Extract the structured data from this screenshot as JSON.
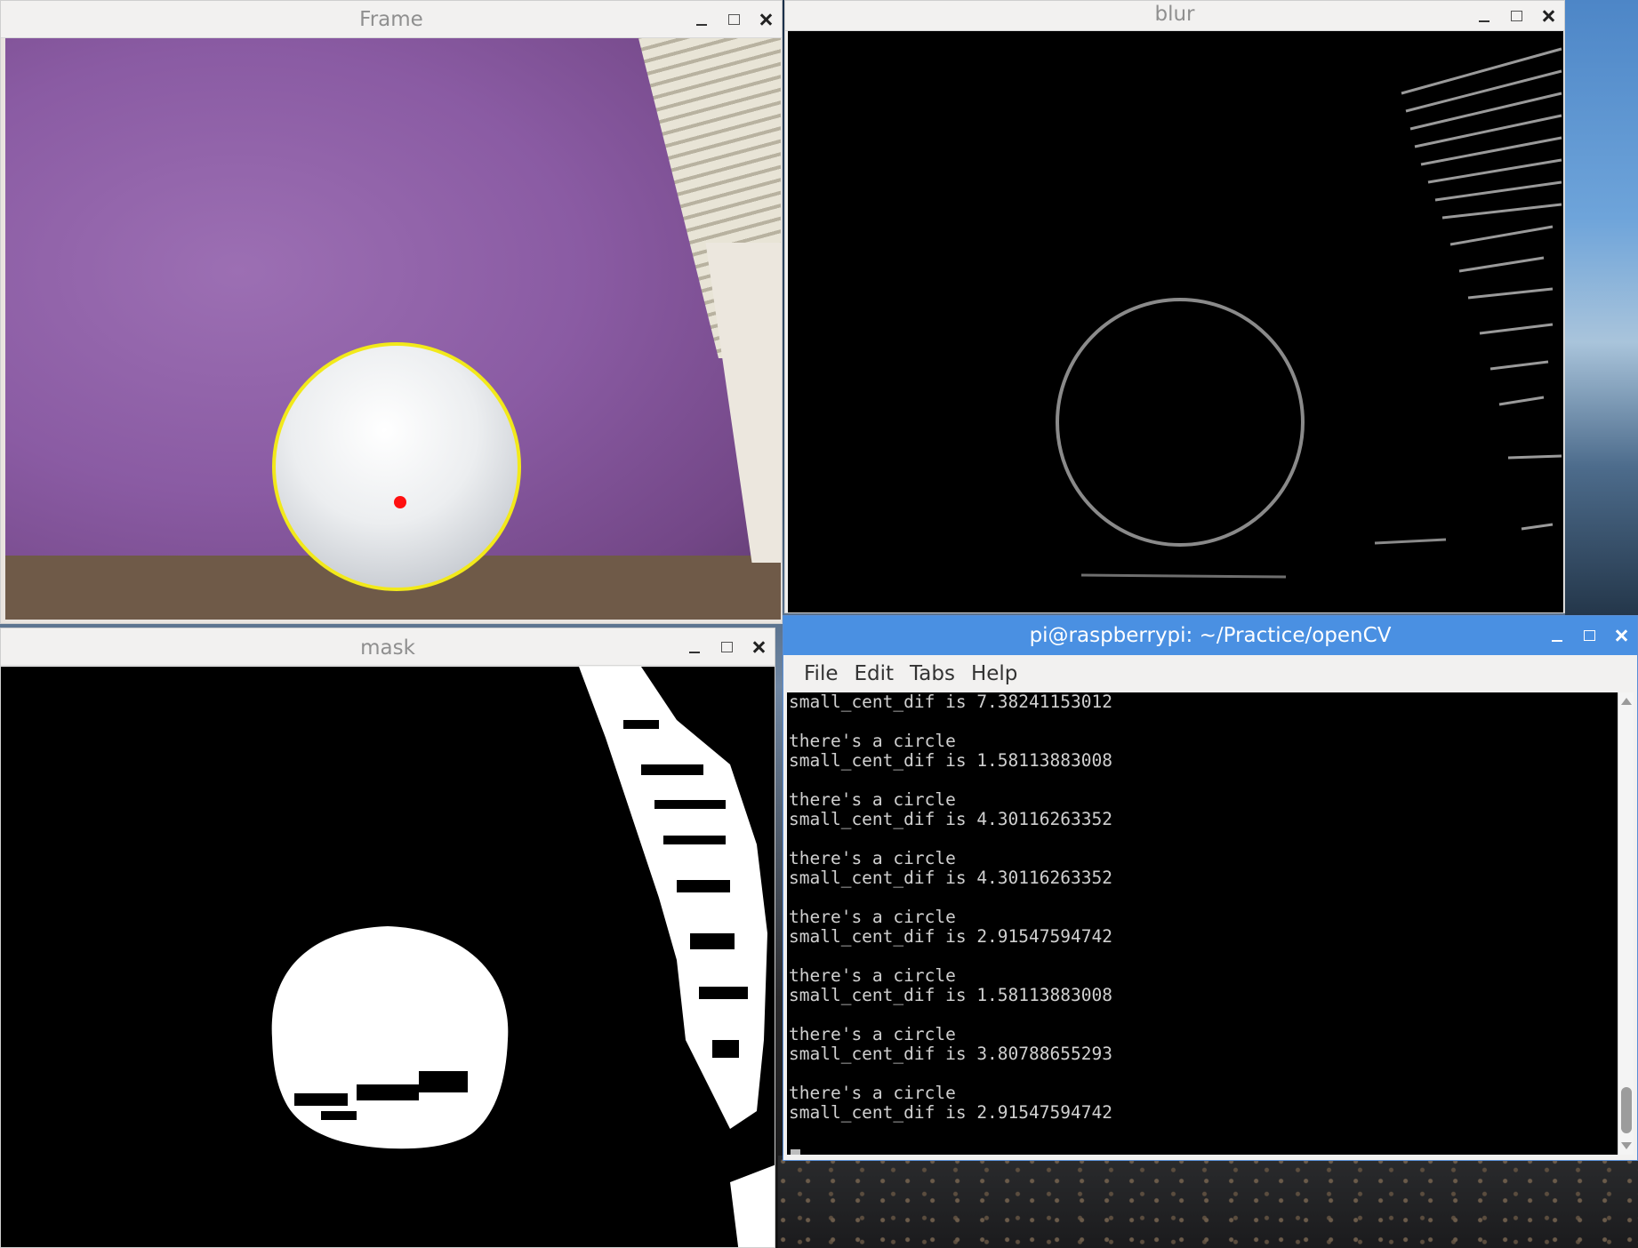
{
  "windows": {
    "frame": {
      "title": "Frame"
    },
    "blur": {
      "title": "blur"
    },
    "mask": {
      "title": "mask"
    },
    "terminal": {
      "title": "pi@raspberrypi: ~/Practice/openCV",
      "menu": [
        "File",
        "Edit",
        "Tabs",
        "Help"
      ],
      "lines": [
        "small_cent_dif is 7.38241153012",
        "",
        "there's a circle",
        "small_cent_dif is 1.58113883008",
        "",
        "there's a circle",
        "small_cent_dif is 4.30116263352",
        "",
        "there's a circle",
        "small_cent_dif is 4.30116263352",
        "",
        "there's a circle",
        "small_cent_dif is 2.91547594742",
        "",
        "there's a circle",
        "small_cent_dif is 1.58113883008",
        "",
        "there's a circle",
        "small_cent_dif is 3.80788655293",
        "",
        "there's a circle",
        "small_cent_dif is 2.91547594742",
        ""
      ]
    }
  },
  "colors": {
    "circle_outline": "#f2e91a",
    "center_dot": "#ff1010",
    "terminal_titlebar": "#4a90e2"
  },
  "icons": [
    "minimize-icon",
    "maximize-icon",
    "close-icon"
  ]
}
